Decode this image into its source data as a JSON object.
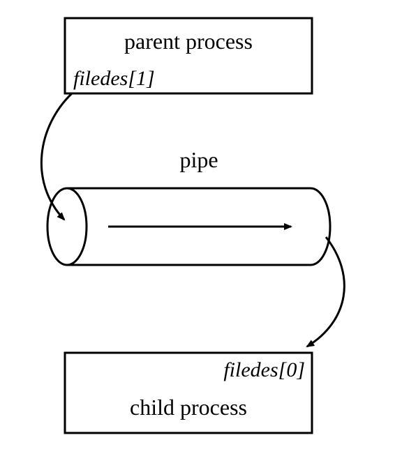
{
  "parent": {
    "title": "parent process",
    "fd_label": "filedes[1]"
  },
  "pipe": {
    "label": "pipe"
  },
  "child": {
    "title": "child process",
    "fd_label": "filedes[0]"
  }
}
